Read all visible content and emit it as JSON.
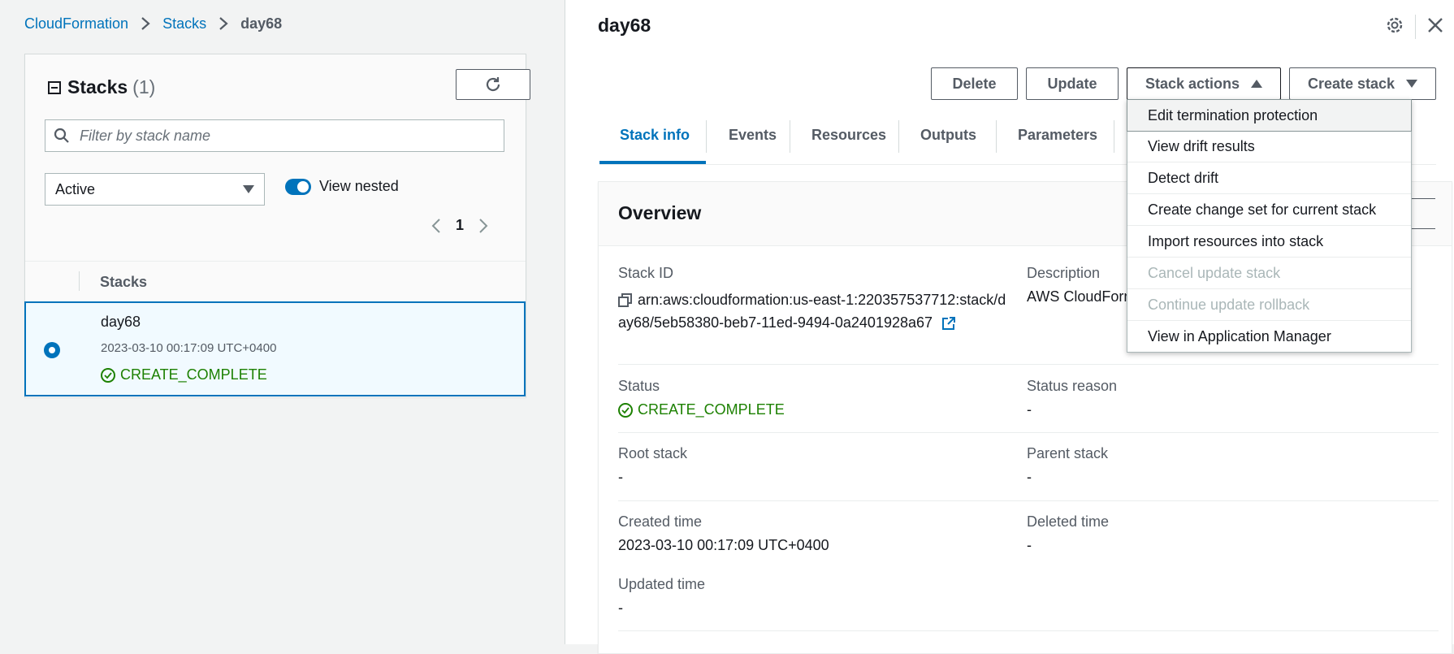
{
  "breadcrumb": {
    "items": [
      "CloudFormation",
      "Stacks"
    ],
    "current": "day68"
  },
  "stacks_panel": {
    "title": "Stacks",
    "count": "(1)",
    "search_placeholder": "Filter by stack name",
    "filter_selected": "Active",
    "toggle_label": "View nested",
    "toggle_on": true,
    "page": "1",
    "column_header": "Stacks",
    "rows": [
      {
        "name": "day68",
        "created": "2023-03-10 00:17:09 UTC+0400",
        "status": "CREATE_COMPLETE",
        "selected": true
      }
    ]
  },
  "detail": {
    "title": "day68",
    "buttons": {
      "delete": "Delete",
      "update": "Update",
      "stack_actions": "Stack actions",
      "create_stack": "Create stack"
    },
    "tabs": [
      "Stack info",
      "Events",
      "Resources",
      "Outputs",
      "Parameters"
    ],
    "active_tab": "Stack info",
    "overview": {
      "title": "Overview",
      "stack_id_label": "Stack ID",
      "stack_id_value": "arn:aws:cloudformation:us-east-1:220357537712:stack/day68/5eb58380-beb7-11ed-9494-0a2401928a67",
      "description_label": "Description",
      "description_value": "AWS CloudForm",
      "status_label": "Status",
      "status_value": "CREATE_COMPLETE",
      "status_reason_label": "Status reason",
      "status_reason_value": "-",
      "root_stack_label": "Root stack",
      "root_stack_value": "-",
      "parent_stack_label": "Parent stack",
      "parent_stack_value": "-",
      "created_time_label": "Created time",
      "created_time_value": "2023-03-10 00:17:09 UTC+0400",
      "deleted_time_label": "Deleted time",
      "deleted_time_value": "-",
      "updated_time_label": "Updated time",
      "updated_time_value": "-"
    }
  },
  "stack_actions_menu": {
    "items": [
      {
        "label": "Edit termination protection",
        "enabled": true
      },
      {
        "label": "View drift results",
        "enabled": true
      },
      {
        "label": "Detect drift",
        "enabled": true
      },
      {
        "label": "Create change set for current stack",
        "enabled": true
      },
      {
        "label": "Import resources into stack",
        "enabled": true
      },
      {
        "label": "Cancel update stack",
        "enabled": false
      },
      {
        "label": "Continue update rollback",
        "enabled": false
      },
      {
        "label": "View in Application Manager",
        "enabled": true
      }
    ]
  },
  "colors": {
    "link": "#0073bb",
    "success": "#1d8102",
    "disabled": "#aab7b8"
  }
}
